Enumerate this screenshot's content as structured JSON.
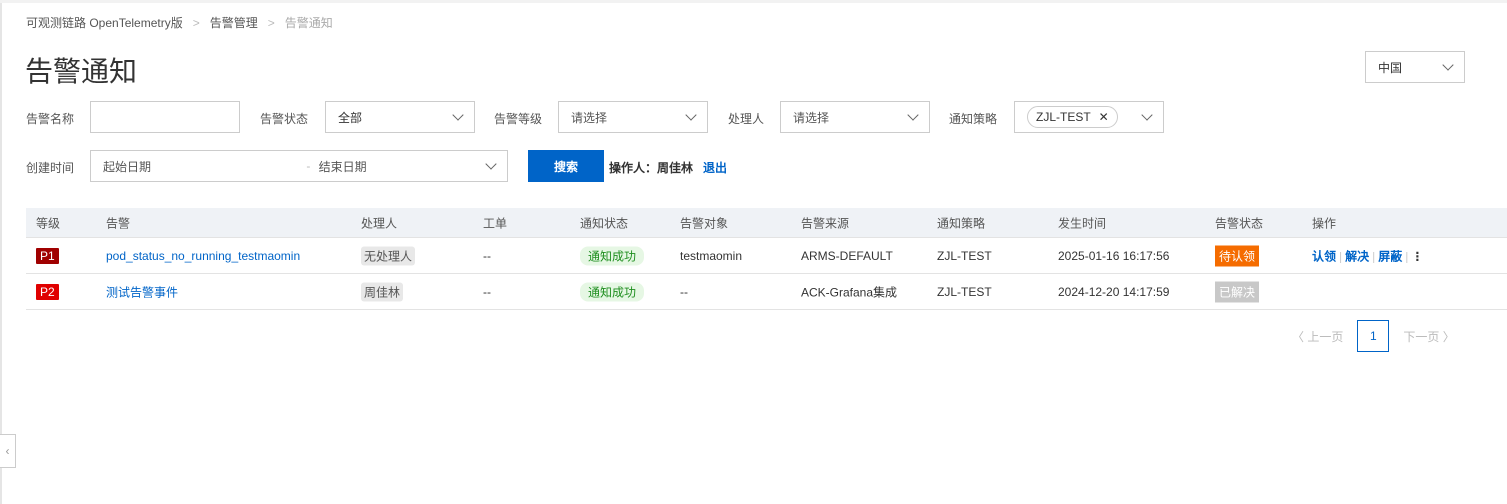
{
  "breadcrumb": [
    "可观测链路 OpenTelemetry版",
    "告警管理",
    "告警通知"
  ],
  "page_title": "告警通知",
  "region": "中国",
  "filters": {
    "alert_name_label": "告警名称",
    "alert_name_value": "",
    "alert_status_label": "告警状态",
    "alert_status_value": "全部",
    "alert_level_label": "告警等级",
    "alert_level_placeholder": "请选择",
    "handler_label": "处理人",
    "handler_placeholder": "请选择",
    "policy_label": "通知策略",
    "policy_tag": "ZJL-TEST",
    "created_label": "创建时间",
    "start_placeholder": "起始日期",
    "range_sep": "-",
    "end_placeholder": "结束日期",
    "search_button": "搜索",
    "operator_label": "操作人：周佳林",
    "logout": "退出"
  },
  "table": {
    "headers": [
      "等级",
      "告警",
      "处理人",
      "工单",
      "通知状态",
      "告警对象",
      "告警来源",
      "通知策略",
      "发生时间",
      "告警状态",
      "操作"
    ],
    "rows": [
      {
        "level": "P1",
        "level_color": "#a00000",
        "alert": "pod_status_no_running_testmaomin",
        "handler": "无处理人",
        "ticket": "--",
        "notify": "通知成功",
        "target": "testmaomin",
        "source": "ARMS-DEFAULT",
        "policy": "ZJL-TEST",
        "time": "2025-01-16 16:17:56",
        "status": "待认领",
        "status_color": "#f56c00",
        "actions": [
          "认领",
          "解决",
          "屏蔽"
        ]
      },
      {
        "level": "P2",
        "level_color": "#e00000",
        "alert": "测试告警事件",
        "handler": "周佳林",
        "ticket": "--",
        "notify": "通知成功",
        "target": "--",
        "source": "ACK-Grafana集成",
        "policy": "ZJL-TEST",
        "time": "2024-12-20 14:17:59",
        "status": "已解决",
        "status_color": "#c8c8c8",
        "actions": []
      }
    ]
  },
  "pagination": {
    "prev": "上一页",
    "current": "1",
    "next": "下一页"
  }
}
